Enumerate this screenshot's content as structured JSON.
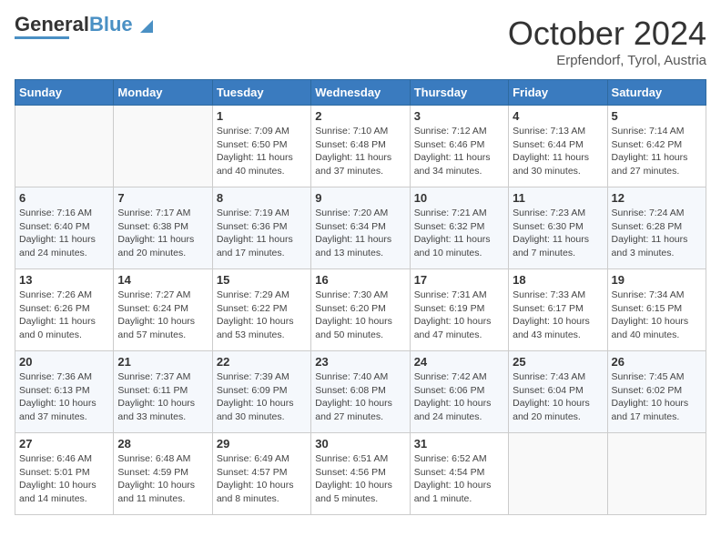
{
  "header": {
    "logo_general": "General",
    "logo_blue": "Blue",
    "month_title": "October 2024",
    "location": "Erpfendorf, Tyrol, Austria"
  },
  "weekdays": [
    "Sunday",
    "Monday",
    "Tuesday",
    "Wednesday",
    "Thursday",
    "Friday",
    "Saturday"
  ],
  "weeks": [
    [
      {
        "day": "",
        "info": ""
      },
      {
        "day": "",
        "info": ""
      },
      {
        "day": "1",
        "info": "Sunrise: 7:09 AM\nSunset: 6:50 PM\nDaylight: 11 hours and 40 minutes."
      },
      {
        "day": "2",
        "info": "Sunrise: 7:10 AM\nSunset: 6:48 PM\nDaylight: 11 hours and 37 minutes."
      },
      {
        "day": "3",
        "info": "Sunrise: 7:12 AM\nSunset: 6:46 PM\nDaylight: 11 hours and 34 minutes."
      },
      {
        "day": "4",
        "info": "Sunrise: 7:13 AM\nSunset: 6:44 PM\nDaylight: 11 hours and 30 minutes."
      },
      {
        "day": "5",
        "info": "Sunrise: 7:14 AM\nSunset: 6:42 PM\nDaylight: 11 hours and 27 minutes."
      }
    ],
    [
      {
        "day": "6",
        "info": "Sunrise: 7:16 AM\nSunset: 6:40 PM\nDaylight: 11 hours and 24 minutes."
      },
      {
        "day": "7",
        "info": "Sunrise: 7:17 AM\nSunset: 6:38 PM\nDaylight: 11 hours and 20 minutes."
      },
      {
        "day": "8",
        "info": "Sunrise: 7:19 AM\nSunset: 6:36 PM\nDaylight: 11 hours and 17 minutes."
      },
      {
        "day": "9",
        "info": "Sunrise: 7:20 AM\nSunset: 6:34 PM\nDaylight: 11 hours and 13 minutes."
      },
      {
        "day": "10",
        "info": "Sunrise: 7:21 AM\nSunset: 6:32 PM\nDaylight: 11 hours and 10 minutes."
      },
      {
        "day": "11",
        "info": "Sunrise: 7:23 AM\nSunset: 6:30 PM\nDaylight: 11 hours and 7 minutes."
      },
      {
        "day": "12",
        "info": "Sunrise: 7:24 AM\nSunset: 6:28 PM\nDaylight: 11 hours and 3 minutes."
      }
    ],
    [
      {
        "day": "13",
        "info": "Sunrise: 7:26 AM\nSunset: 6:26 PM\nDaylight: 11 hours and 0 minutes."
      },
      {
        "day": "14",
        "info": "Sunrise: 7:27 AM\nSunset: 6:24 PM\nDaylight: 10 hours and 57 minutes."
      },
      {
        "day": "15",
        "info": "Sunrise: 7:29 AM\nSunset: 6:22 PM\nDaylight: 10 hours and 53 minutes."
      },
      {
        "day": "16",
        "info": "Sunrise: 7:30 AM\nSunset: 6:20 PM\nDaylight: 10 hours and 50 minutes."
      },
      {
        "day": "17",
        "info": "Sunrise: 7:31 AM\nSunset: 6:19 PM\nDaylight: 10 hours and 47 minutes."
      },
      {
        "day": "18",
        "info": "Sunrise: 7:33 AM\nSunset: 6:17 PM\nDaylight: 10 hours and 43 minutes."
      },
      {
        "day": "19",
        "info": "Sunrise: 7:34 AM\nSunset: 6:15 PM\nDaylight: 10 hours and 40 minutes."
      }
    ],
    [
      {
        "day": "20",
        "info": "Sunrise: 7:36 AM\nSunset: 6:13 PM\nDaylight: 10 hours and 37 minutes."
      },
      {
        "day": "21",
        "info": "Sunrise: 7:37 AM\nSunset: 6:11 PM\nDaylight: 10 hours and 33 minutes."
      },
      {
        "day": "22",
        "info": "Sunrise: 7:39 AM\nSunset: 6:09 PM\nDaylight: 10 hours and 30 minutes."
      },
      {
        "day": "23",
        "info": "Sunrise: 7:40 AM\nSunset: 6:08 PM\nDaylight: 10 hours and 27 minutes."
      },
      {
        "day": "24",
        "info": "Sunrise: 7:42 AM\nSunset: 6:06 PM\nDaylight: 10 hours and 24 minutes."
      },
      {
        "day": "25",
        "info": "Sunrise: 7:43 AM\nSunset: 6:04 PM\nDaylight: 10 hours and 20 minutes."
      },
      {
        "day": "26",
        "info": "Sunrise: 7:45 AM\nSunset: 6:02 PM\nDaylight: 10 hours and 17 minutes."
      }
    ],
    [
      {
        "day": "27",
        "info": "Sunrise: 6:46 AM\nSunset: 5:01 PM\nDaylight: 10 hours and 14 minutes."
      },
      {
        "day": "28",
        "info": "Sunrise: 6:48 AM\nSunset: 4:59 PM\nDaylight: 10 hours and 11 minutes."
      },
      {
        "day": "29",
        "info": "Sunrise: 6:49 AM\nSunset: 4:57 PM\nDaylight: 10 hours and 8 minutes."
      },
      {
        "day": "30",
        "info": "Sunrise: 6:51 AM\nSunset: 4:56 PM\nDaylight: 10 hours and 5 minutes."
      },
      {
        "day": "31",
        "info": "Sunrise: 6:52 AM\nSunset: 4:54 PM\nDaylight: 10 hours and 1 minute."
      },
      {
        "day": "",
        "info": ""
      },
      {
        "day": "",
        "info": ""
      }
    ]
  ]
}
